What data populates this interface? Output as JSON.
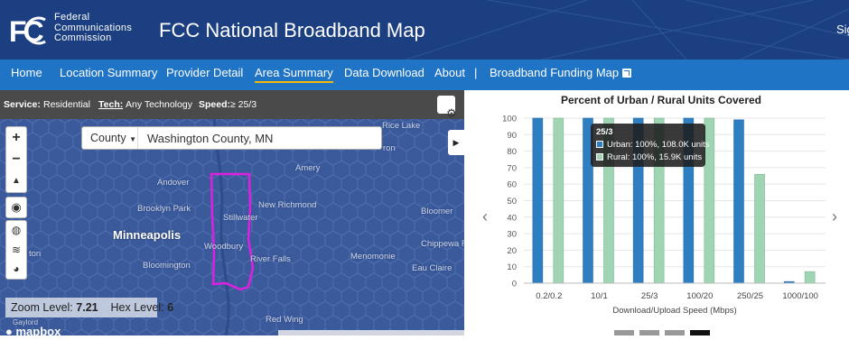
{
  "header": {
    "agency_line1": "Federal",
    "agency_line2": "Communications",
    "agency_line3": "Commission",
    "title": "FCC National Broadband Map",
    "sign_in": "Sig"
  },
  "nav": {
    "items": [
      {
        "label": "Home"
      },
      {
        "label": "Location Summary"
      },
      {
        "label": "Provider Detail"
      },
      {
        "label": "Area Summary"
      },
      {
        "label": "Data Download"
      },
      {
        "label": "About"
      }
    ],
    "separator": "|",
    "funding": "Broadband Funding Map",
    "active": "Area Summary"
  },
  "map": {
    "filters": {
      "service_label": "Service:",
      "service_value": "Residential",
      "tech_label": "Tech:",
      "tech_value": "Any Technology",
      "speed_label": "Speed:",
      "speed_value": "≥ 25/3"
    },
    "search": {
      "scope": "County",
      "value": "Washington County, MN"
    },
    "cities": [
      "Rice Lake",
      "Amery",
      "Andover",
      "New Richmond",
      "Brooklyn Park",
      "Stillwater",
      "Bloomer",
      "Minneapolis",
      "Woodbury",
      "Chippewa F",
      "Menomonie",
      "River Falls",
      "Bloomington",
      "Eau Claire",
      "Red Wing",
      "Gaylord",
      "ron",
      "ton"
    ],
    "zoom_label": "Zoom Level:",
    "zoom_value": "7.21",
    "hex_label": "Hex Level:",
    "hex_value": "6",
    "logo": "mapbox",
    "colors": {
      "map_fill": "#3a5a9c",
      "hex_line": "#5674b3",
      "county_outline": "#e020e0"
    }
  },
  "chart_data": {
    "type": "bar",
    "title": "Percent of Urban / Rural Units Covered",
    "xlabel": "Download/Upload Speed (Mbps)",
    "ylabel": "",
    "categories": [
      "0.2/0.2",
      "10/1",
      "25/3",
      "100/20",
      "250/25",
      "1000/100"
    ],
    "ylim": [
      0,
      100
    ],
    "yticks": [
      0,
      10,
      20,
      30,
      40,
      50,
      60,
      70,
      80,
      90,
      100
    ],
    "series": [
      {
        "name": "Urban",
        "color": "#2e7fc2",
        "values": [
          100,
          100,
          100,
          100,
          99,
          1
        ]
      },
      {
        "name": "Rural",
        "color": "#9fd5b3",
        "values": [
          100,
          100,
          100,
          100,
          66,
          7
        ]
      }
    ],
    "tooltip": {
      "title": "25/3",
      "urban": "Urban: 100%, 108.0K units",
      "rural": "Rural: 100%, 15.9K units"
    }
  }
}
